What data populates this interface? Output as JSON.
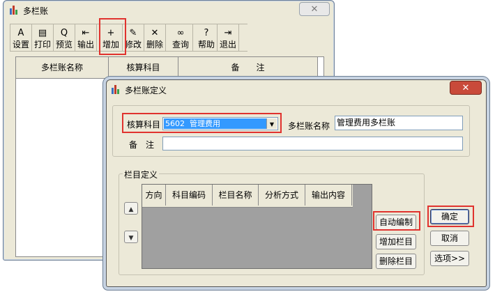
{
  "background_window": {
    "title": "多栏账",
    "toolbar": [
      {
        "key": "setup",
        "label": "设置",
        "icon": "page-setup-icon"
      },
      {
        "key": "print",
        "label": "打印",
        "icon": "printer-icon"
      },
      {
        "key": "preview",
        "label": "预览",
        "icon": "magnifier-page-icon"
      },
      {
        "key": "export",
        "label": "输出",
        "icon": "export-icon"
      },
      {
        "key": "add",
        "label": "增加",
        "icon": "add-page-icon"
      },
      {
        "key": "modify",
        "label": "修改",
        "icon": "edit-icon"
      },
      {
        "key": "delete",
        "label": "删除",
        "icon": "x-delete-icon"
      },
      {
        "key": "query",
        "label": "查询",
        "icon": "binoculars-icon"
      },
      {
        "key": "help",
        "label": "帮助",
        "icon": "question-icon"
      },
      {
        "key": "exit",
        "label": "退出",
        "icon": "exit-door-icon"
      }
    ],
    "table_headers": [
      "多栏账名称",
      "核算科目",
      "备　　注"
    ]
  },
  "dialog": {
    "title": "多栏账定义",
    "account_label": "核算科目",
    "account_value": "5602  管理费用",
    "name_label": "多栏账名称",
    "name_value": "管理费用多栏账",
    "note_label": "备　注",
    "note_value": "",
    "column_group_label": "栏目定义",
    "column_headers": [
      "方向",
      "科目编码",
      "栏目名称",
      "分析方式",
      "输出内容"
    ],
    "buttons": {
      "auto": "自动编制",
      "add_col": "增加栏目",
      "del_col": "删除栏目",
      "ok": "确定",
      "cancel": "取消",
      "options": "选项>>"
    }
  },
  "colors": {
    "window_face": "#ece9d8",
    "highlight_red": "#e0322e",
    "selection_blue": "#3399ff",
    "grid_gray": "#a0a0a0"
  }
}
